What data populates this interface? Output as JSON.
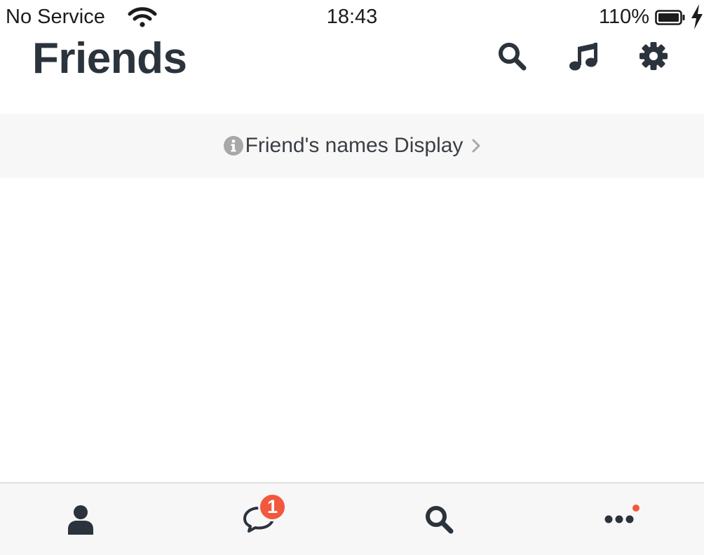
{
  "status_bar": {
    "carrier": "No Service",
    "time": "18:43",
    "battery": "110%",
    "icons": [
      "wifi-icon",
      "battery-icon",
      "charging-bolt-icon"
    ]
  },
  "header": {
    "title": "Friends",
    "actions": [
      "search-icon",
      "music-note-icon",
      "gear-icon"
    ]
  },
  "banner": {
    "text": "Friend's names Display",
    "icons": [
      "info-icon",
      "chevron-right-icon"
    ]
  },
  "tab_bar": {
    "tabs": [
      {
        "icon": "person-icon"
      },
      {
        "icon": "chat-bubble-icon",
        "badge": "1"
      },
      {
        "icon": "search-icon"
      },
      {
        "icon": "more-dots-icon",
        "has_dot": true
      }
    ]
  },
  "colors": {
    "text_dark": "#2b333d",
    "banner_bg": "#f7f7f7",
    "badge_red": "#f2583e",
    "info_gray": "#a8a8a8"
  }
}
